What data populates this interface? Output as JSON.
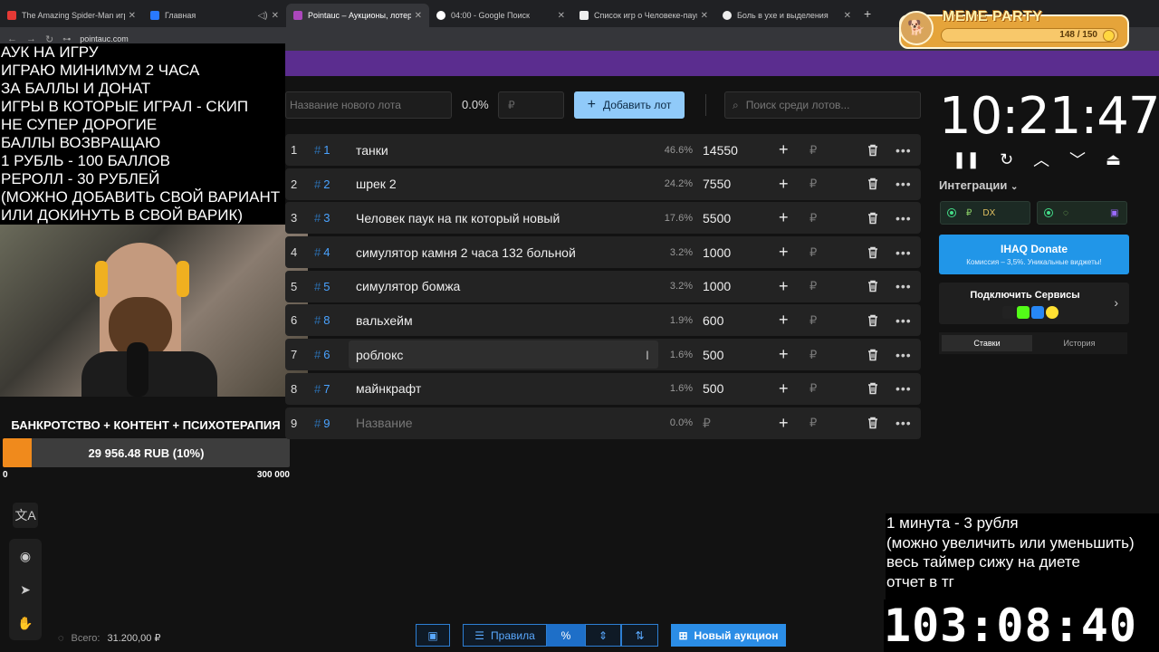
{
  "browser": {
    "tabs": [
      {
        "title": "The Amazing Spider-Man игра",
        "color": "#e53935"
      },
      {
        "title": "Главная",
        "color": "#2979ff"
      },
      {
        "title": "Pointauc – Аукционы, лотереи",
        "color": "#ab47bc"
      },
      {
        "title": "04:00 - Google Поиск",
        "color": "#ffffff"
      },
      {
        "title": "Список игр о Человеке-пауке",
        "color": "#eeeeee"
      },
      {
        "title": "Боль в ухе и выделения",
        "color": "#eeeeee"
      }
    ],
    "url": "pointauc.com"
  },
  "meme_party": {
    "title": "MEME PARTY",
    "count": "148 / 150"
  },
  "overlay_left": {
    "lines": [
      "АУК НА ИГРУ",
      "ИГРАЮ МИНИМУМ 2 ЧАСА",
      "ЗА БАЛЛЫ И ДОНАТ",
      "ИГРЫ В КОТОРЫЕ ИГРАЛ - СКИП",
      "НЕ СУПЕР ДОРОГИЕ",
      "БАЛЛЫ ВОЗВРАЩАЮ",
      "1 РУБЛЬ - 100 БАЛЛОВ",
      "РЕРОЛЛ - 30 РУБЛЕЙ",
      "(МОЖНО ДОБАВИТЬ СВОЙ ВАРИАНТ",
      "ИЛИ ДОКИНУТЬ В СВОЙ ВАРИК)"
    ]
  },
  "donation": {
    "title": "БАНКРОТСТВО + КОНТЕНТ + ПСИХОТЕРАПИЯ",
    "value": "29 956.48 RUB (10%)",
    "progress_fraction": 0.1,
    "min": "0",
    "max": "300 000"
  },
  "toolbar_top": {
    "lot_name_placeholder": "Название нового лота",
    "percent": "0.0%",
    "price_placeholder": "₽",
    "add_button": "Добавить лот",
    "search_placeholder": "Поиск среди лотов..."
  },
  "lots": [
    {
      "num": "1",
      "fast": "1",
      "name": "танки",
      "pct": "46.6%",
      "amount": "14550"
    },
    {
      "num": "2",
      "fast": "2",
      "name": "шрек 2",
      "pct": "24.2%",
      "amount": "7550"
    },
    {
      "num": "3",
      "fast": "3",
      "name": "Человек паук на пк который новый",
      "pct": "17.6%",
      "amount": "5500"
    },
    {
      "num": "4",
      "fast": "4",
      "name": "симулятор камня 2 часа 132 больной",
      "pct": "3.2%",
      "amount": "1000"
    },
    {
      "num": "5",
      "fast": "5",
      "name": "симулятор бомжа",
      "pct": "3.2%",
      "amount": "1000"
    },
    {
      "num": "6",
      "fast": "8",
      "name": "вальхейм",
      "pct": "1.9%",
      "amount": "600"
    },
    {
      "num": "7",
      "fast": "6",
      "name": "роблокс",
      "pct": "1.6%",
      "amount": "500"
    },
    {
      "num": "8",
      "fast": "7",
      "name": "майнкрафт",
      "pct": "1.6%",
      "amount": "500"
    },
    {
      "num": "9",
      "fast": "9",
      "name": "Название",
      "pct": "0.0%",
      "amount": "₽"
    }
  ],
  "currency": "₽",
  "timer": "10:21:47",
  "integrations": {
    "label": "Интеграции",
    "ihaq_title": "IHAQ Donate",
    "ihaq_sub": "Комиссия – 3,5%. Уникальные виджеты!",
    "connect_title": "Подключить Сервисы",
    "tabs": [
      "Ставки",
      "История"
    ]
  },
  "overlay_right": {
    "lines": [
      "1 минута - 3 рубля",
      "(можно увеличить или уменьшить)",
      "весь таймер сижу на диете",
      "отчет в тг"
    ],
    "timer": "103:08:40"
  },
  "bottom": {
    "total_label": "Всего:",
    "total_value": "31.200,00 ₽",
    "rules": "Правила",
    "percent_symbol": "%",
    "new_auction": "Новый аукцион"
  }
}
